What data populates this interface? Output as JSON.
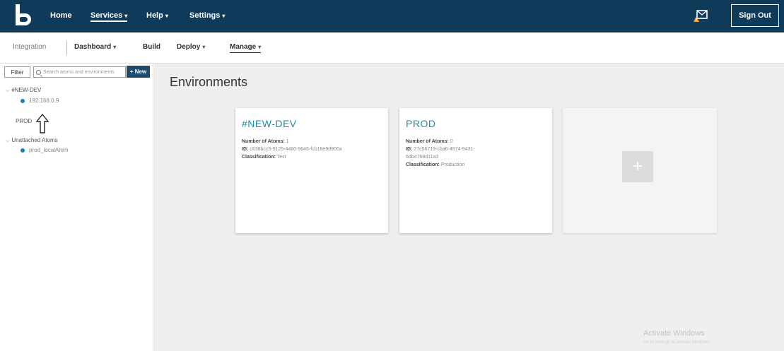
{
  "topnav": {
    "items": [
      {
        "label": "Home",
        "dropdown": false
      },
      {
        "label": "Services",
        "dropdown": true,
        "active": true
      },
      {
        "label": "Help",
        "dropdown": true
      },
      {
        "label": "Settings",
        "dropdown": true
      }
    ],
    "signout_label": "Sign Out",
    "caret": "▾",
    "icons": {
      "logo": "boomi-logo-icon",
      "alerts": "notification-icon"
    }
  },
  "subnav": {
    "integration_label": "Integration",
    "dashboard_label": "Dashboard",
    "build_label": "Build",
    "deploy_label": "Deploy",
    "manage_label": "Manage"
  },
  "sidebar": {
    "filter_label": "Filter",
    "search_placeholder": "Search atoms and environments",
    "new_label": "+ New",
    "groups": [
      {
        "label": "#NEW-DEV",
        "items": [
          {
            "label": "192.168.0.9"
          }
        ]
      },
      {
        "label": "PROD",
        "items": []
      },
      {
        "label": "Unattached Atoms",
        "items": [
          {
            "label": "prod_localAtom"
          }
        ]
      }
    ],
    "chevron": "⌵",
    "collapse_glyph": "‹"
  },
  "main": {
    "title": "Environments",
    "cards": [
      {
        "name": "#NEW-DEV",
        "atoms_label": "Number of Atoms:",
        "atoms_value": "1",
        "id_label": "ID:",
        "id_value": "c638bcc5-5125-4480-9646-fcb18e9d900a",
        "id_value_2": "",
        "class_label": "Classification:",
        "class_value": "Test"
      },
      {
        "name": "PROD",
        "atoms_label": "Number of Atoms:",
        "atoms_value": "0",
        "id_label": "ID:",
        "id_value": "27c56719-cba6-4974-9431-",
        "id_value_2": "6db4768d11a3",
        "class_label": "Classification:",
        "class_value": "Production"
      }
    ],
    "add_glyph": "+"
  },
  "watermark": {
    "title": "Activate Windows",
    "subtitle": "Go to Settings to activate Windows."
  },
  "colors": {
    "topbar": "#0f3a5a",
    "accent": "#1a8fb0",
    "atom_dot": "#1a7fc1",
    "new_button": "#1e4a6e"
  }
}
